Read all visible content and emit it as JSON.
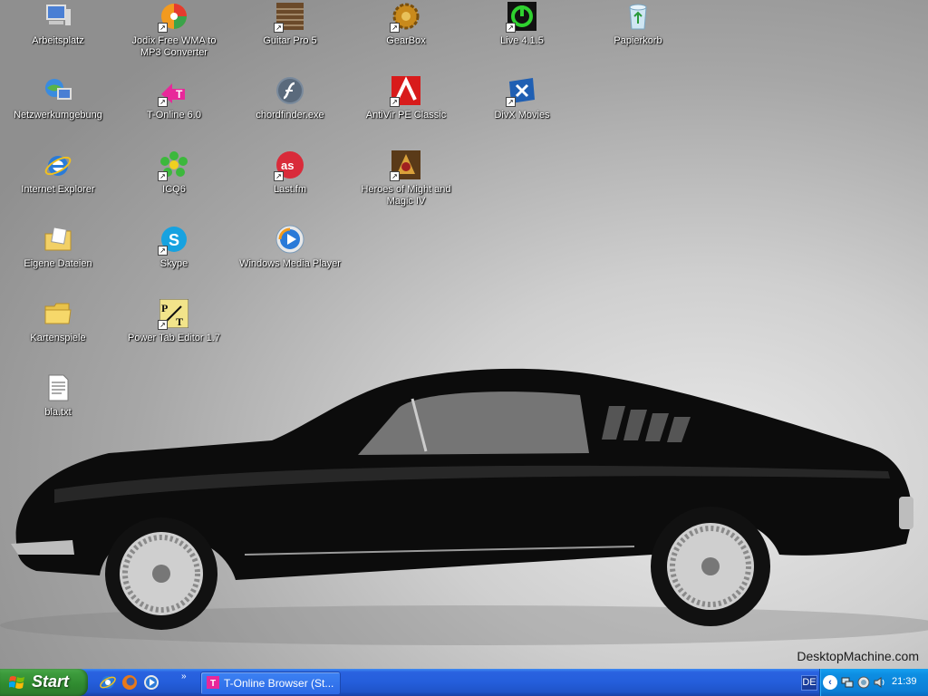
{
  "desktop": {
    "watermark": "DesktopMachine.com",
    "icons": [
      {
        "id": "arbeitsplatz",
        "label": "Arbeitsplatz",
        "icon": "my-computer-icon",
        "shortcut": false
      },
      {
        "id": "jodix",
        "label": "Jodix Free WMA to MP3 Converter",
        "icon": "jodix-converter-icon",
        "shortcut": true
      },
      {
        "id": "guitarpro",
        "label": "Guitar Pro 5",
        "icon": "guitar-pro-icon",
        "shortcut": true
      },
      {
        "id": "gearbox",
        "label": "GearBox",
        "icon": "gearbox-icon",
        "shortcut": true
      },
      {
        "id": "live",
        "label": "Live 4.1.5",
        "icon": "ableton-live-icon",
        "shortcut": true
      },
      {
        "id": "papierkorb",
        "label": "Papierkorb",
        "icon": "recycle-bin-icon",
        "shortcut": false
      },
      {
        "id": "netzwerk",
        "label": "Netzwerkumgebung",
        "icon": "network-places-icon",
        "shortcut": false
      },
      {
        "id": "tonline",
        "label": "T-Online 6.0",
        "icon": "t-online-icon",
        "shortcut": true
      },
      {
        "id": "chordfinder",
        "label": "chordfinder.exe",
        "icon": "flash-icon",
        "shortcut": false
      },
      {
        "id": "antivir",
        "label": "AntiVir PE Classic",
        "icon": "antivir-icon",
        "shortcut": true
      },
      {
        "id": "divx",
        "label": "DivX Movies",
        "icon": "divx-icon",
        "shortcut": true
      },
      {
        "id": "ie",
        "label": "Internet Explorer",
        "icon": "internet-explorer-icon",
        "shortcut": false
      },
      {
        "id": "icq",
        "label": "ICQ6",
        "icon": "icq-flower-icon",
        "shortcut": true
      },
      {
        "id": "lastfm",
        "label": "Last.fm",
        "icon": "lastfm-icon",
        "shortcut": true
      },
      {
        "id": "heroes",
        "label": "Heroes of Might and Magic IV",
        "icon": "heroes-game-icon",
        "shortcut": true
      },
      {
        "id": "eigene",
        "label": "Eigene Dateien",
        "icon": "my-documents-icon",
        "shortcut": false
      },
      {
        "id": "skype",
        "label": "Skype",
        "icon": "skype-icon",
        "shortcut": true
      },
      {
        "id": "wmp",
        "label": "Windows Media Player",
        "icon": "media-player-icon",
        "shortcut": false
      },
      {
        "id": "kartenspiele",
        "label": "Kartenspiele",
        "icon": "folder-icon",
        "shortcut": false
      },
      {
        "id": "powertab",
        "label": "Power Tab Editor 1.7",
        "icon": "power-tab-icon",
        "shortcut": true
      },
      {
        "id": "bla",
        "label": "bla.txt",
        "icon": "text-file-icon",
        "shortcut": false
      }
    ]
  },
  "taskbar": {
    "start_label": "Start",
    "quick_launch": [
      "ie-quicklaunch-icon",
      "firefox-quicklaunch-icon",
      "media-player-quicklaunch-icon"
    ],
    "quick_launch_more": "»",
    "task_item_label": "T-Online Browser (St...",
    "language": "DE",
    "tray_chevron": "‹",
    "clock": "21:39"
  },
  "colors": {
    "taskbar_blue": "#245edb",
    "start_green": "#3d9c3d",
    "tray_blue": "#0b7fd6"
  }
}
